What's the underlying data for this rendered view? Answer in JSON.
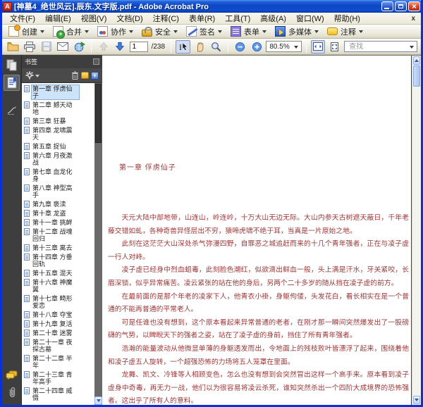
{
  "window": {
    "title": "[神墓4_绝世风云].辰东.文字版.pdf - Adobe Acrobat Pro"
  },
  "menubar": {
    "items": [
      {
        "name": "file",
        "label": "文件(F)"
      },
      {
        "name": "edit",
        "label": "编辑(E)"
      },
      {
        "name": "view",
        "label": "视图(V)"
      },
      {
        "name": "document",
        "label": "文档(D)"
      },
      {
        "name": "comments",
        "label": "注释(C)"
      },
      {
        "name": "forms",
        "label": "表单(R)"
      },
      {
        "name": "tools",
        "label": "工具(T)"
      },
      {
        "name": "advanced",
        "label": "高级(A)"
      },
      {
        "name": "window",
        "label": "窗口(W)"
      },
      {
        "name": "help",
        "label": "帮助(H)"
      }
    ],
    "close_label": "x"
  },
  "toolbar_primary": {
    "buttons": [
      {
        "name": "create",
        "label": "创建",
        "icon": "create-icon"
      },
      {
        "name": "combine",
        "label": "合并",
        "icon": "combine-icon"
      },
      {
        "name": "collaborate",
        "label": "协作",
        "icon": "collaborate-icon"
      },
      {
        "name": "secure",
        "label": "安全",
        "icon": "secure-icon"
      },
      {
        "name": "sign",
        "label": "签名",
        "icon": "sign-icon"
      },
      {
        "name": "forms",
        "label": "表单",
        "icon": "forms-icon"
      },
      {
        "name": "multimedia",
        "label": "多媒体",
        "icon": "multimedia-icon"
      },
      {
        "name": "comment",
        "label": "注释",
        "icon": "comment-icon"
      }
    ]
  },
  "toolbar_secondary": {
    "page_current": "1",
    "page_total": "/238",
    "zoom_level": "80.5%",
    "find_placeholder": "查找"
  },
  "sidebar": {
    "panel_title": "书签",
    "bookmarks": [
      {
        "label": "第一章 俘虏仙子",
        "selected": true
      },
      {
        "label": "第二章 撼天动地"
      },
      {
        "label": "第三章 狂暴"
      },
      {
        "label": "第四章 龙啸震天"
      },
      {
        "label": "第五章 捉仙"
      },
      {
        "label": "第六章 月夜激战"
      },
      {
        "label": "第七章 血龙化身"
      },
      {
        "label": "第八章 神型高手"
      },
      {
        "label": "第九章 亵渎"
      },
      {
        "label": "第十章 龙盗"
      },
      {
        "label": "第十一章 挑衅"
      },
      {
        "label": "第十二章 战魂回归"
      },
      {
        "label": "第十三章 离去"
      },
      {
        "label": "第十四章 方垂回轨"
      },
      {
        "label": "第十五章 混天"
      },
      {
        "label": "第十六章 神魔翼"
      },
      {
        "label": "第十七章 畸形爱恋"
      },
      {
        "label": "第十八章 夺宝"
      },
      {
        "label": "第十九章 复活"
      },
      {
        "label": "第二十章 迷雾"
      },
      {
        "label": "第二十一章 夜探古墓"
      },
      {
        "label": "第二十二章 半年"
      },
      {
        "label": "第二十三章 青年高手"
      },
      {
        "label": "第二十四章 威慑"
      }
    ]
  },
  "document": {
    "chapter_title": "第一章 俘虏仙子",
    "paragraphs": [
      "天元大陆中部地带，山连山，岭连岭，十万大山无边无际。大山内参天古树遮天蔽日，千年老藤交错如虬，各种奇兽异怪层出不穷，猿啼虎啸不绝于耳，当真是一片原始之地。",
      "此刻在这茫茫大山深处杀气弥漫四野，自罪恶之城追赶而来的十几个青年强者，正在与凌子虚一行人对峙。",
      "凌子虚已经身中烈血蛆毒，此刻脸色潮红，似欲滴出鲜血一般，头上满是汗水，牙关紧咬，长眉深锁，似乎异常痛苦。凌云紧张的站在他的身后，另两个二十多岁的随从挡在凌子虚的前方。",
      "在最前面的是那个年老的凌家下人，他青衣小褂，身躯佝偻，头发花白，看长相实在是一个普通的不能再普通的平常老人。",
      "可是任谁也没有想到，这个原本看起来异常普通的老者，在刚才那一瞬间突然爆发出了一股磅礴的气势，以睥睨天下的强者之姿，站在了凌子虚的身前，挡住了所有青年强者。",
      "浩瀚的能量波动从他微显单薄的身躯透发而出，令地面上的残枝败叶皆漂浮了起来，围绕着他和凌子虚五人旋转，一个超强恐怖的力场将五人笼罩在里面。",
      "龙舞、凯文、冷锋等人相顾变色，怎么也没有想到会突然冒出这样一个高手来。原本看到凌子虚身中奇毒，再无力一战，他们以为很容易将凌云杀死，谁知突然杀出一个四阶大成境界的恐怖强者。这出乎了所有人的意料。"
    ]
  },
  "colors": {
    "window_border": "#0831d9",
    "titlebar_blue": "#0d46c6",
    "sidebar_bg": "#3e3e3e",
    "doc_text": "#9c3638",
    "bookmark_selected_bg": "#cde3f7"
  }
}
